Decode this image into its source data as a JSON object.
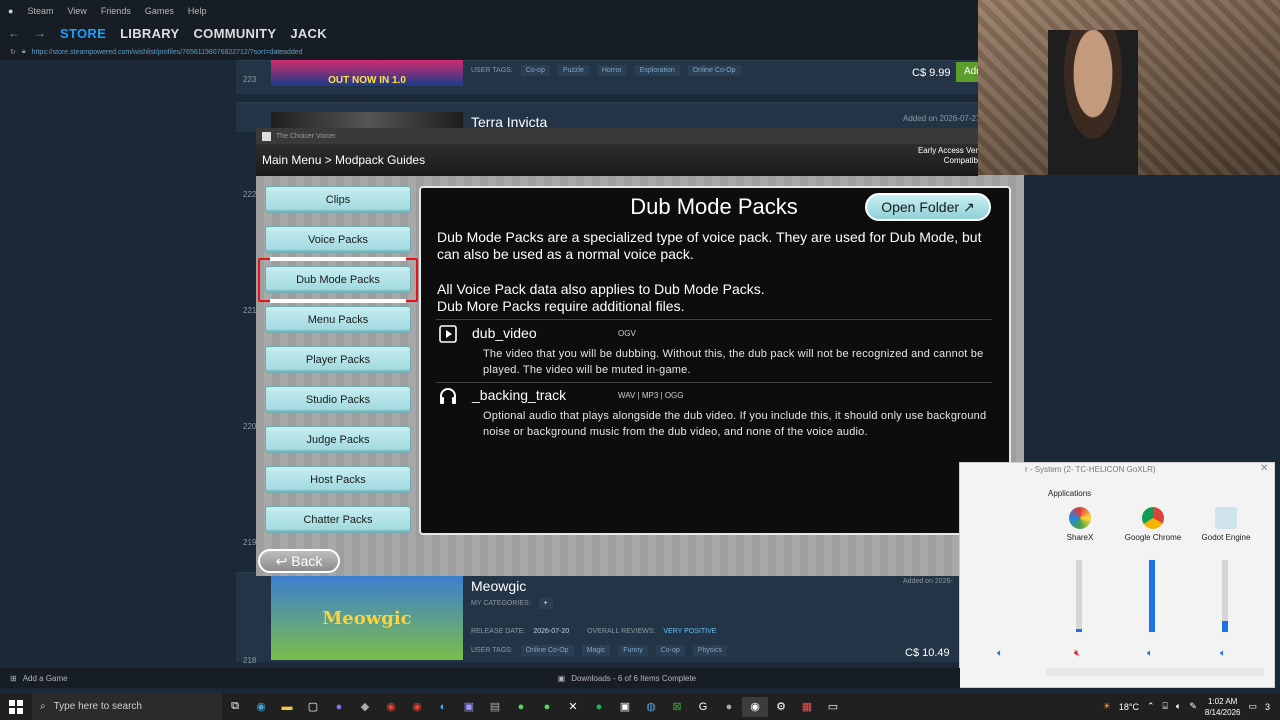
{
  "steam": {
    "menu": [
      "Steam",
      "View",
      "Friends",
      "Games",
      "Help"
    ],
    "nav": {
      "store": "STORE",
      "library": "LIBRARY",
      "community": "COMMUNITY",
      "user": "JACK"
    },
    "url": "https://store.steampowered.com/wishlist/profiles/76561198076822712/?sort=dateadded",
    "bottom": {
      "add_game": "Add a Game",
      "downloads": "Downloads - 6 of 6 Items Complete"
    }
  },
  "wishlist": {
    "row1": {
      "rank": "223",
      "capsule_text": "OUT NOW IN 1.0",
      "tags_label": "USER TAGS:",
      "tags": [
        "Co-op",
        "Puzzle",
        "Horror",
        "Exploration",
        "Online Co-Op"
      ],
      "price": "C$ 9.99",
      "add": "Add"
    },
    "row2": {
      "rank": "222",
      "title": "Terra Invicta",
      "added": "Added on 2026-07-27"
    },
    "side_ranks": [
      "221",
      "220",
      "219"
    ],
    "row_last": {
      "rank": "218",
      "title": "Meowgic",
      "capsule_text": "Meowgic",
      "added": "Added on 2026-",
      "categories_label": "MY CATEGORIES:",
      "plus": "+",
      "release_label": "RELEASE DATE:",
      "release": "2026-07-20",
      "reviews_label": "OVERALL REVIEWS:",
      "reviews": "VERY POSITIVE",
      "tags_label": "USER TAGS:",
      "tags": [
        "Online Co-Op",
        "Magic",
        "Funny",
        "Co-op",
        "Physics"
      ],
      "price": "C$ 10.49"
    }
  },
  "app": {
    "window_title": "The Choicer Voicer",
    "breadcrumb": "Main Menu > Modpack Guides",
    "early_access": [
      "Early Access Ver",
      "Compatib"
    ],
    "sidebar": [
      "Clips",
      "Voice Packs",
      "Dub Mode Packs",
      "Menu Packs",
      "Player Packs",
      "Studio Packs",
      "Judge Packs",
      "Host Packs",
      "Chatter Packs"
    ],
    "selected_index": 2,
    "panel": {
      "title": "Dub Mode Packs",
      "open_folder": "Open Folder",
      "para1": "Dub Mode Packs are a specialized type of voice pack. They are used for Dub Mode, but can also be used as a normal voice pack.",
      "para2_line1": "All Voice Pack data also applies to Dub Mode Packs.",
      "para2_line2": "Dub More Packs require additional files.",
      "entries": [
        {
          "icon": "play-icon",
          "name": "dub_video",
          "types": "OGV",
          "desc": "The video that you will be dubbing. Without this, the dub pack will not be recognized and cannot be played. The video will be muted in-game."
        },
        {
          "icon": "headphones-icon",
          "name": "_backing_track",
          "types": "WAV | MP3 | OGG",
          "desc": "Optional audio that plays alongside the dub video. If you include this, it should only use background noise or background music from the dub video, and none of the voice audio."
        }
      ]
    },
    "back": "Back"
  },
  "mixer": {
    "title": "r - System (2- TC-HELICON GoXLR)",
    "applications_label": "Applications",
    "apps": [
      {
        "name": "ShareX",
        "level": 0.0
      },
      {
        "name": "Google Chrome",
        "level": 1.0
      },
      {
        "name": "Godot Engine",
        "level": 0.15
      }
    ]
  },
  "taskbar": {
    "search_placeholder": "Type here to search",
    "weather": "18°C",
    "time": "1:02 AM",
    "date": "8/14/2026",
    "notifications": "3"
  }
}
